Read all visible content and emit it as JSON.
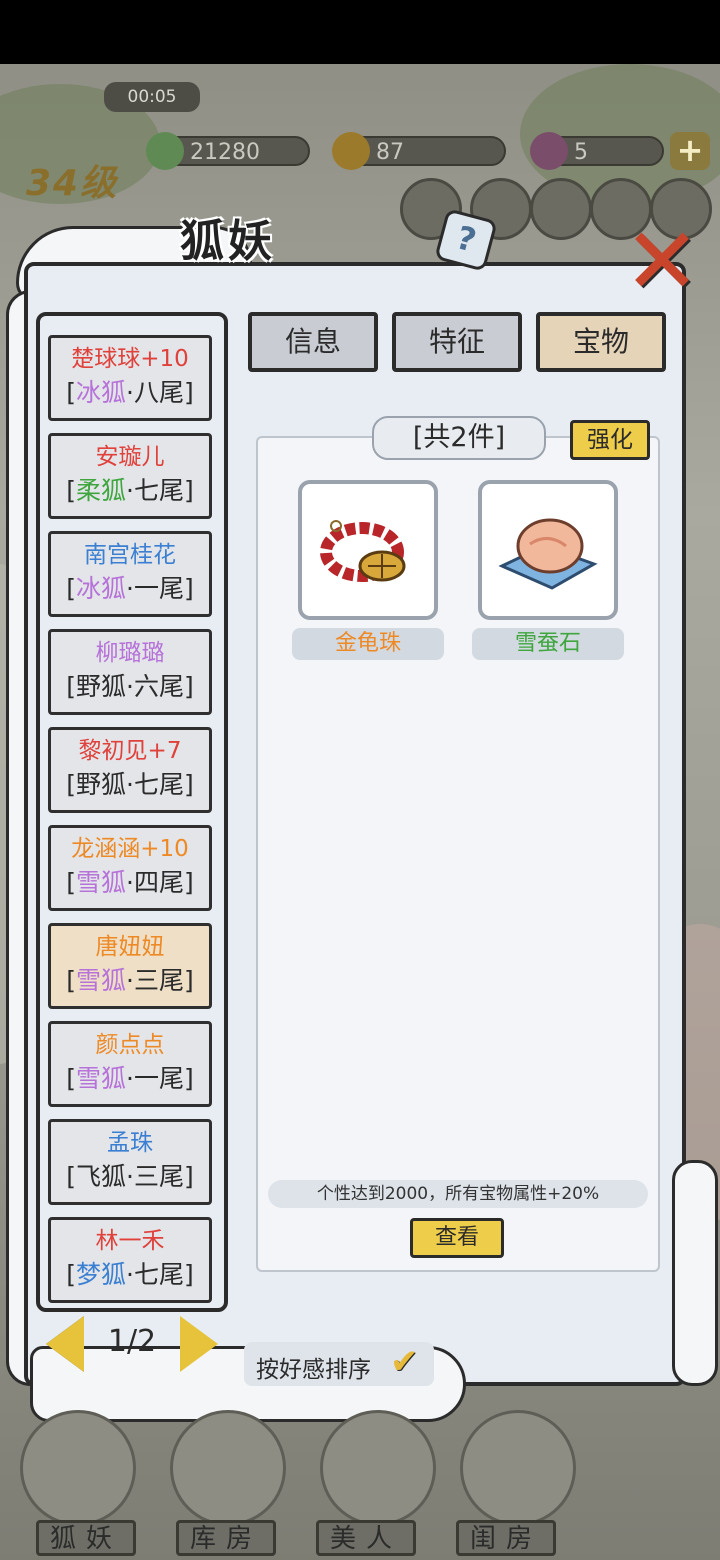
{
  "hud": {
    "timer": "00:05",
    "level": "34级",
    "jade": "21280",
    "gold": "87",
    "gems": "5",
    "plus": "+"
  },
  "panel": {
    "title": "狐妖",
    "help": "?",
    "close": "✕"
  },
  "tabs": [
    {
      "label": "信息"
    },
    {
      "label": "特征"
    },
    {
      "label": "宝物"
    }
  ],
  "characters": [
    {
      "name": "楚球球+10",
      "type_open": "[",
      "race": "冰狐",
      "tail": "·八尾]"
    },
    {
      "name": "安璇儿",
      "type_open": "[",
      "race": "柔狐",
      "tail": "·七尾]"
    },
    {
      "name": "南宫桂花",
      "type_open": "[",
      "race": "冰狐",
      "tail": "·一尾]"
    },
    {
      "name": "柳璐璐",
      "type_open": "[",
      "race": "野狐",
      "tail": "·六尾]"
    },
    {
      "name": "黎初见+7",
      "type_open": "[",
      "race": "野狐",
      "tail": "·七尾]"
    },
    {
      "name": "龙涵涵+10",
      "type_open": "[",
      "race": "雪狐",
      "tail": "·四尾]"
    },
    {
      "name": "唐妞妞",
      "type_open": "[",
      "race": "雪狐",
      "tail": "·三尾]"
    },
    {
      "name": "颜点点",
      "type_open": "[",
      "race": "雪狐",
      "tail": "·一尾]"
    },
    {
      "name": "孟珠",
      "type_open": "[",
      "race": "飞狐",
      "tail": "·三尾]"
    },
    {
      "name": "林一禾",
      "type_open": "[",
      "race": "梦狐",
      "tail": "·七尾]"
    }
  ],
  "pager": {
    "page": "1/2"
  },
  "treasure": {
    "count": "[共2件]",
    "strengthen": "强化",
    "items": [
      {
        "name": "金龟珠",
        "icon": "turtle-bead-bracelet-icon"
      },
      {
        "name": "雪蚕石",
        "icon": "snow-silkworm-stone-icon"
      }
    ],
    "effect": "个性达到2000，所有宝物属性+20%",
    "view": "查看"
  },
  "sort": {
    "label": "按好感排序"
  },
  "nav": [
    {
      "label": "狐妖"
    },
    {
      "label": "库房"
    },
    {
      "label": "美人"
    },
    {
      "label": "闺房"
    }
  ],
  "colors": {
    "panel_bg": "#e8edf3",
    "selected_item": "#efdfc6",
    "active_tab": "#e6d4b8",
    "button_yellow": "#eecd4a",
    "close_red": "#c8452c"
  }
}
